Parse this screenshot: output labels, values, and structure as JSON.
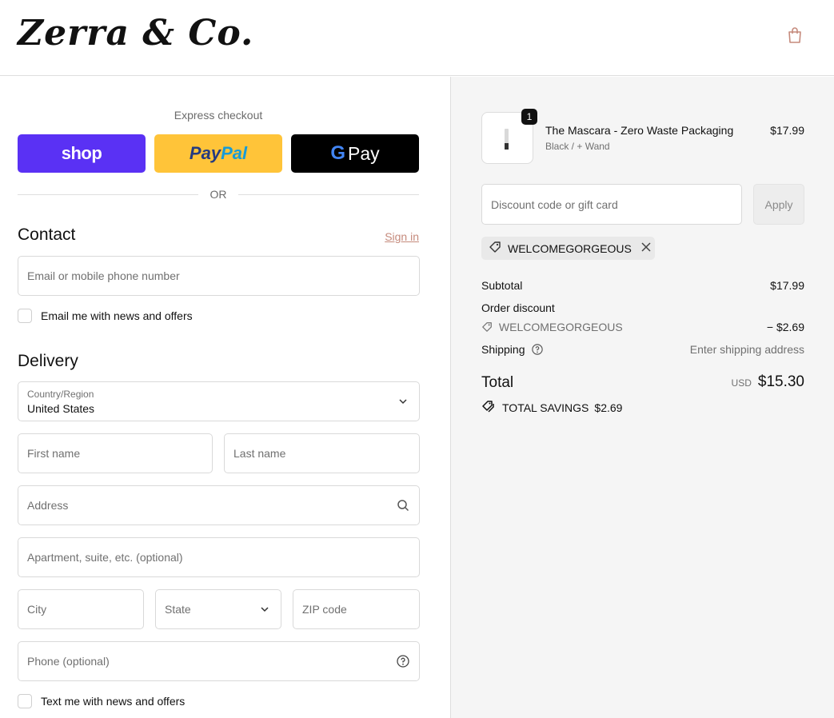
{
  "header": {
    "logo": "Zerra & Co.",
    "bag_icon": "shopping-bag-icon"
  },
  "express": {
    "label": "Express checkout",
    "shop_label": "shop",
    "paypal_pay": "Pay",
    "paypal_pal": "Pal",
    "gpay_label": "Pay",
    "or_label": "OR"
  },
  "contact": {
    "title": "Contact",
    "sign_in": "Sign in",
    "email_placeholder": "Email or mobile phone number",
    "newsletter_label": "Email me with news and offers"
  },
  "delivery": {
    "title": "Delivery",
    "country_label": "Country/Region",
    "country_value": "United States",
    "first_name": "First name",
    "last_name": "Last name",
    "address": "Address",
    "apartment": "Apartment, suite, etc. (optional)",
    "city": "City",
    "state": "State",
    "zip": "ZIP code",
    "phone": "Phone (optional)",
    "sms_label": "Text me with news and offers"
  },
  "order": {
    "quantity": "1",
    "product_name": "The Mascara - Zero Waste Packaging",
    "product_variant": "Black / + Wand",
    "product_price": "$17.99",
    "discount_placeholder": "Discount code or gift card",
    "apply_label": "Apply",
    "applied_code": "WELCOMEGORGEOUS",
    "subtotal_label": "Subtotal",
    "subtotal_value": "$17.99",
    "order_discount_label": "Order discount",
    "discount_code": "WELCOMEGORGEOUS",
    "discount_value": "− $2.69",
    "shipping_label": "Shipping",
    "shipping_value": "Enter shipping address",
    "total_label": "Total",
    "currency": "USD",
    "total_value": "$15.30",
    "savings_label": "TOTAL SAVINGS",
    "savings_value": "$2.69"
  },
  "colors": {
    "shop_purple": "#5a31f4",
    "paypal_yellow": "#ffc439",
    "sign_in_link": "#c58a7c",
    "summary_bg": "#f5f5f5"
  }
}
